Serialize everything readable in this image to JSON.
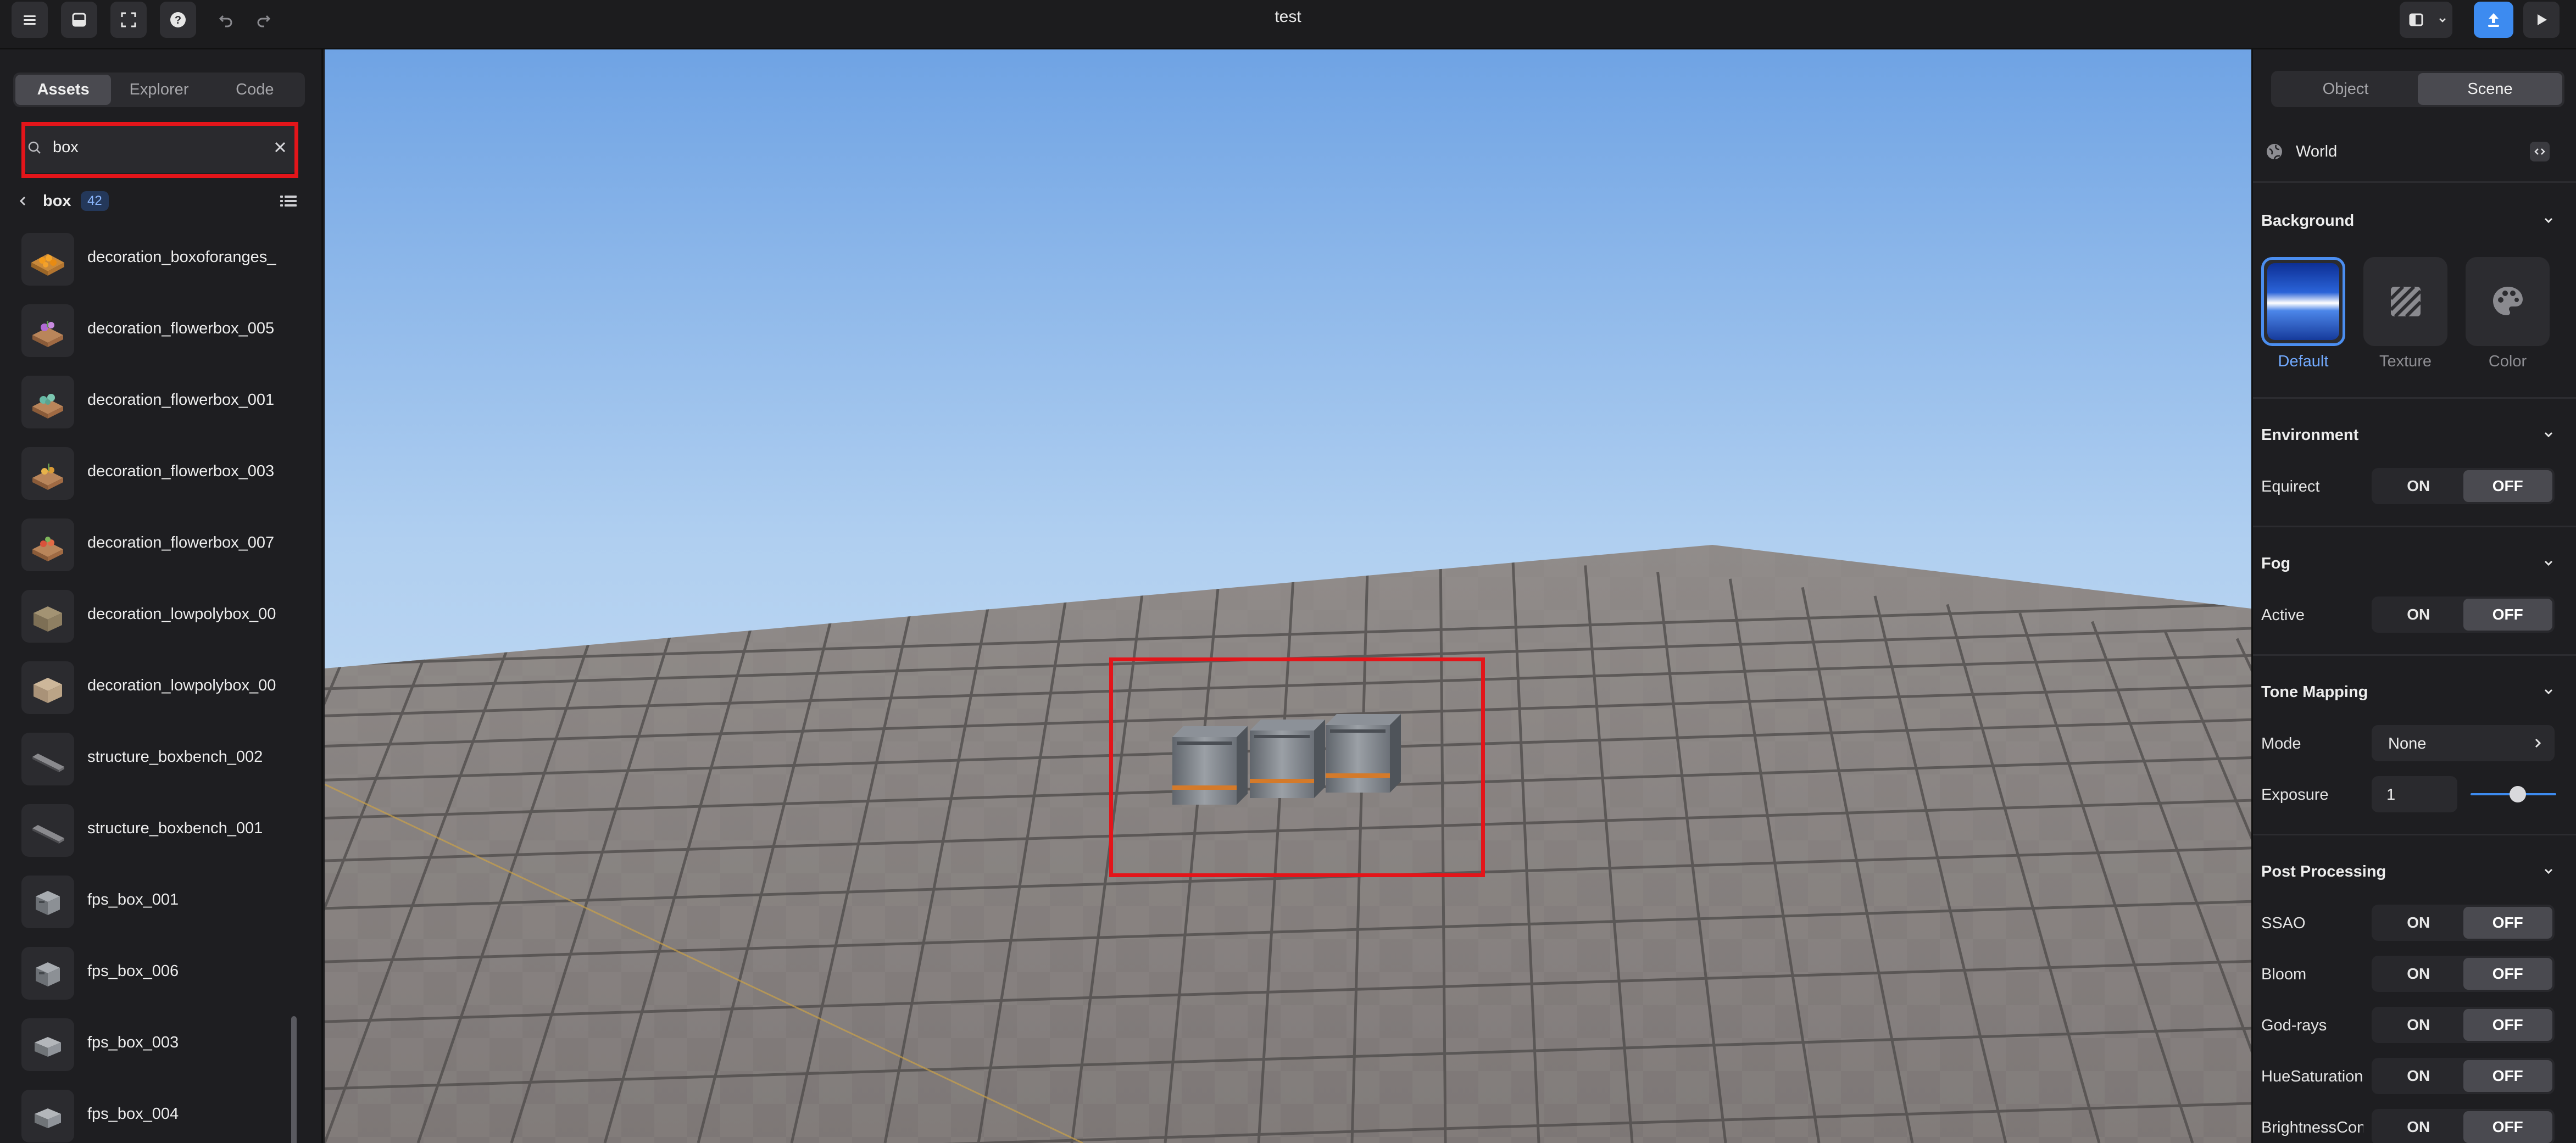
{
  "app": {
    "title": "test"
  },
  "toolbar": {
    "buttons": [
      "menu-icon",
      "save-icon",
      "fullscreen-icon",
      "help-icon",
      "undo-icon",
      "redo-icon"
    ]
  },
  "left_panel": {
    "tabs": [
      "Assets",
      "Explorer",
      "Code"
    ],
    "active_tab": "Assets",
    "search": {
      "value": "box"
    },
    "breadcrumb": {
      "label": "box",
      "count": "42"
    },
    "assets": [
      {
        "name": "decoration_boxoforanges_",
        "thumb": "oranges"
      },
      {
        "name": "decoration_flowerbox_005",
        "thumb": "flower-purple"
      },
      {
        "name": "decoration_flowerbox_001",
        "thumb": "flower-green"
      },
      {
        "name": "decoration_flowerbox_003",
        "thumb": "flower-orange"
      },
      {
        "name": "decoration_flowerbox_007",
        "thumb": "flower-red"
      },
      {
        "name": "decoration_lowpolybox_00",
        "thumb": "lowpoly-dark"
      },
      {
        "name": "decoration_lowpolybox_00",
        "thumb": "lowpoly-light"
      },
      {
        "name": "structure_boxbench_002",
        "thumb": "bench"
      },
      {
        "name": "structure_boxbench_001",
        "thumb": "bench"
      },
      {
        "name": "fps_box_001",
        "thumb": "cube"
      },
      {
        "name": "fps_box_006",
        "thumb": "cube"
      },
      {
        "name": "fps_box_003",
        "thumb": "cube-flat"
      },
      {
        "name": "fps_box_004",
        "thumb": "cube-flat"
      }
    ]
  },
  "right_panel": {
    "tabs": [
      "Object",
      "Scene"
    ],
    "active_tab": "Scene",
    "world_label": "World",
    "background": {
      "title": "Background",
      "options": [
        "Default",
        "Texture",
        "Color"
      ],
      "selected": "Default"
    },
    "environment": {
      "title": "Environment",
      "equirect_label": "Equirect",
      "equirect": "OFF"
    },
    "fog": {
      "title": "Fog",
      "active_label": "Active",
      "active": "OFF"
    },
    "tone_mapping": {
      "title": "Tone Mapping",
      "mode_label": "Mode",
      "mode_value": "None",
      "exposure_label": "Exposure",
      "exposure_value": "1",
      "exposure_slider_fraction": 0.55
    },
    "post_processing": {
      "title": "Post Processing",
      "on_label": "ON",
      "off_label": "OFF",
      "items": [
        {
          "label": "SSAO",
          "value": "OFF"
        },
        {
          "label": "Bloom",
          "value": "OFF"
        },
        {
          "label": "God-rays",
          "value": "OFF"
        },
        {
          "label": "HueSaturation",
          "value": "OFF"
        },
        {
          "label": "BrightnessContrast",
          "value": "OFF"
        }
      ]
    }
  },
  "viewport": {
    "selected_objects": 3
  }
}
